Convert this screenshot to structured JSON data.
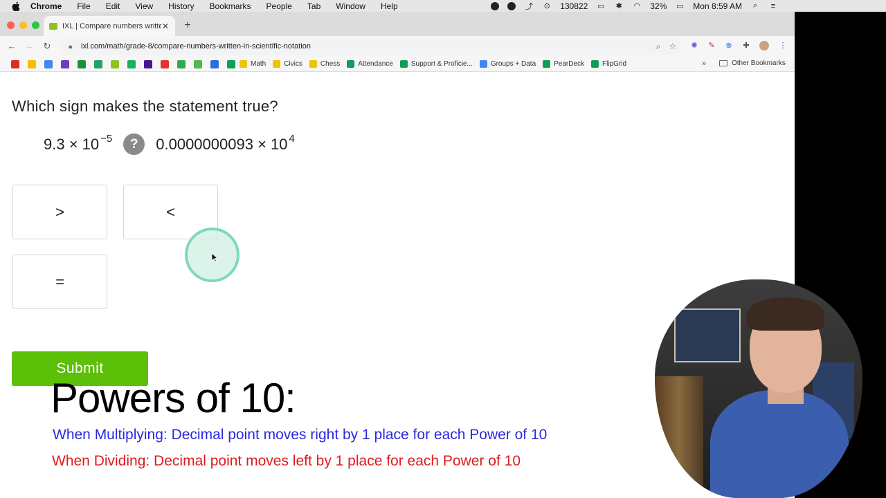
{
  "menubar": {
    "app": "Chrome",
    "items": [
      "File",
      "Edit",
      "View",
      "History",
      "Bookmarks",
      "People",
      "Tab",
      "Window",
      "Help"
    ],
    "status_number": "130822",
    "battery": "32%",
    "clock": "Mon 8:59 AM"
  },
  "browser": {
    "tab_title": "IXL | Compare numbers written",
    "url": "ixl.com/math/grade-8/compare-numbers-written-in-scientific-notation",
    "bookmarks": [
      "Math",
      "Civics",
      "Chess",
      "Attendance",
      "Support & Proficie...",
      "Groups + Data",
      "PearDeck",
      "FlipGrid"
    ],
    "other_bookmarks": "Other Bookmarks",
    "more": "»"
  },
  "question": {
    "prompt": "Which sign makes the statement true?",
    "left_mantissa": "9.3 × 10",
    "left_exponent": "−5",
    "unknown": "?",
    "right_mantissa": "0.0000000093 × 10",
    "right_exponent": "4",
    "choices": [
      ">",
      "<",
      "="
    ],
    "submit_label": "Submit"
  },
  "lesson": {
    "title": "Powers of 10:",
    "multiply_rule": "When Multiplying: Decimal point moves right by 1 place for each Power of 10",
    "divide_rule": "When Dividing: Decimal point moves left by 1 place for each Power of 10",
    "multiply_color": "#2a2adf",
    "divide_color": "#e11b1b"
  },
  "colors": {
    "submit": "#5cbf08",
    "choice_border": "#c8d7e2",
    "click_ripple": "#7ed9bc"
  }
}
